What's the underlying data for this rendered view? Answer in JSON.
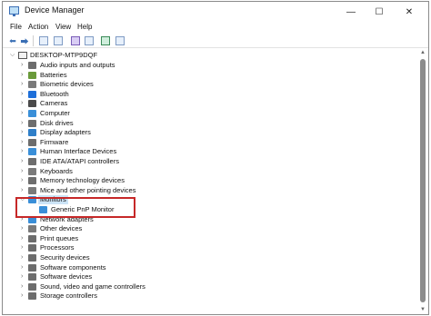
{
  "window": {
    "title": "Device Manager",
    "controls": {
      "minimize": "—",
      "maximize": "☐",
      "close": "✕"
    }
  },
  "menu": [
    "File",
    "Action",
    "View",
    "Help"
  ],
  "toolbar": {
    "back": "back-arrow-icon",
    "forward": "forward-arrow-icon",
    "buttons": [
      "properties-icon",
      "scan-icon",
      "help-icon",
      "device-list-icon",
      "update-driver-icon",
      "monitor-icon"
    ]
  },
  "tree": {
    "root": "DESKTOP-MTP9DQF",
    "items": [
      {
        "label": "Audio inputs and outputs",
        "icon": "speaker-icon",
        "color": "#6d6d6d"
      },
      {
        "label": "Batteries",
        "icon": "battery-icon",
        "color": "#6a9a3a"
      },
      {
        "label": "Biometric devices",
        "icon": "fingerprint-icon",
        "color": "#7a7a7a"
      },
      {
        "label": "Bluetooth",
        "icon": "bluetooth-icon",
        "color": "#1e6fd9"
      },
      {
        "label": "Cameras",
        "icon": "camera-icon",
        "color": "#4a4a4a"
      },
      {
        "label": "Computer",
        "icon": "computer-icon",
        "color": "#3a8fd8"
      },
      {
        "label": "Disk drives",
        "icon": "disk-drive-icon",
        "color": "#6d6d6d"
      },
      {
        "label": "Display adapters",
        "icon": "display-adapter-icon",
        "color": "#2f7fc9"
      },
      {
        "label": "Firmware",
        "icon": "firmware-icon",
        "color": "#6d6d6d"
      },
      {
        "label": "Human Interface Devices",
        "icon": "hid-icon",
        "color": "#3a8fd8"
      },
      {
        "label": "IDE ATA/ATAPI controllers",
        "icon": "ide-controller-icon",
        "color": "#6d6d6d"
      },
      {
        "label": "Keyboards",
        "icon": "keyboard-icon",
        "color": "#7a7a7a"
      },
      {
        "label": "Memory technology devices",
        "icon": "memory-icon",
        "color": "#6d6d6d"
      },
      {
        "label": "Mice and other pointing devices",
        "icon": "mouse-icon",
        "color": "#7a7a7a"
      }
    ],
    "monitors": {
      "label": "Monitors",
      "icon": "monitor-icon",
      "child": {
        "label": "Generic PnP Monitor",
        "icon": "monitor-icon"
      }
    },
    "items_after": [
      {
        "label": "Network adapters",
        "icon": "network-adapter-icon",
        "color": "#3a8fd8"
      },
      {
        "label": "Other devices",
        "icon": "other-devices-icon",
        "color": "#7a7a7a"
      },
      {
        "label": "Print queues",
        "icon": "printer-icon",
        "color": "#6d6d6d"
      },
      {
        "label": "Processors",
        "icon": "processor-icon",
        "color": "#6d6d6d"
      },
      {
        "label": "Security devices",
        "icon": "security-icon",
        "color": "#6d6d6d"
      },
      {
        "label": "Software components",
        "icon": "software-component-icon",
        "color": "#6d6d6d"
      },
      {
        "label": "Software devices",
        "icon": "software-device-icon",
        "color": "#6d6d6d"
      },
      {
        "label": "Sound, video and game controllers",
        "icon": "sound-icon",
        "color": "#6d6d6d"
      },
      {
        "label": "Storage controllers",
        "icon": "storage-controller-icon",
        "color": "#6d6d6d"
      }
    ]
  },
  "accent_highlight": "#c62828"
}
